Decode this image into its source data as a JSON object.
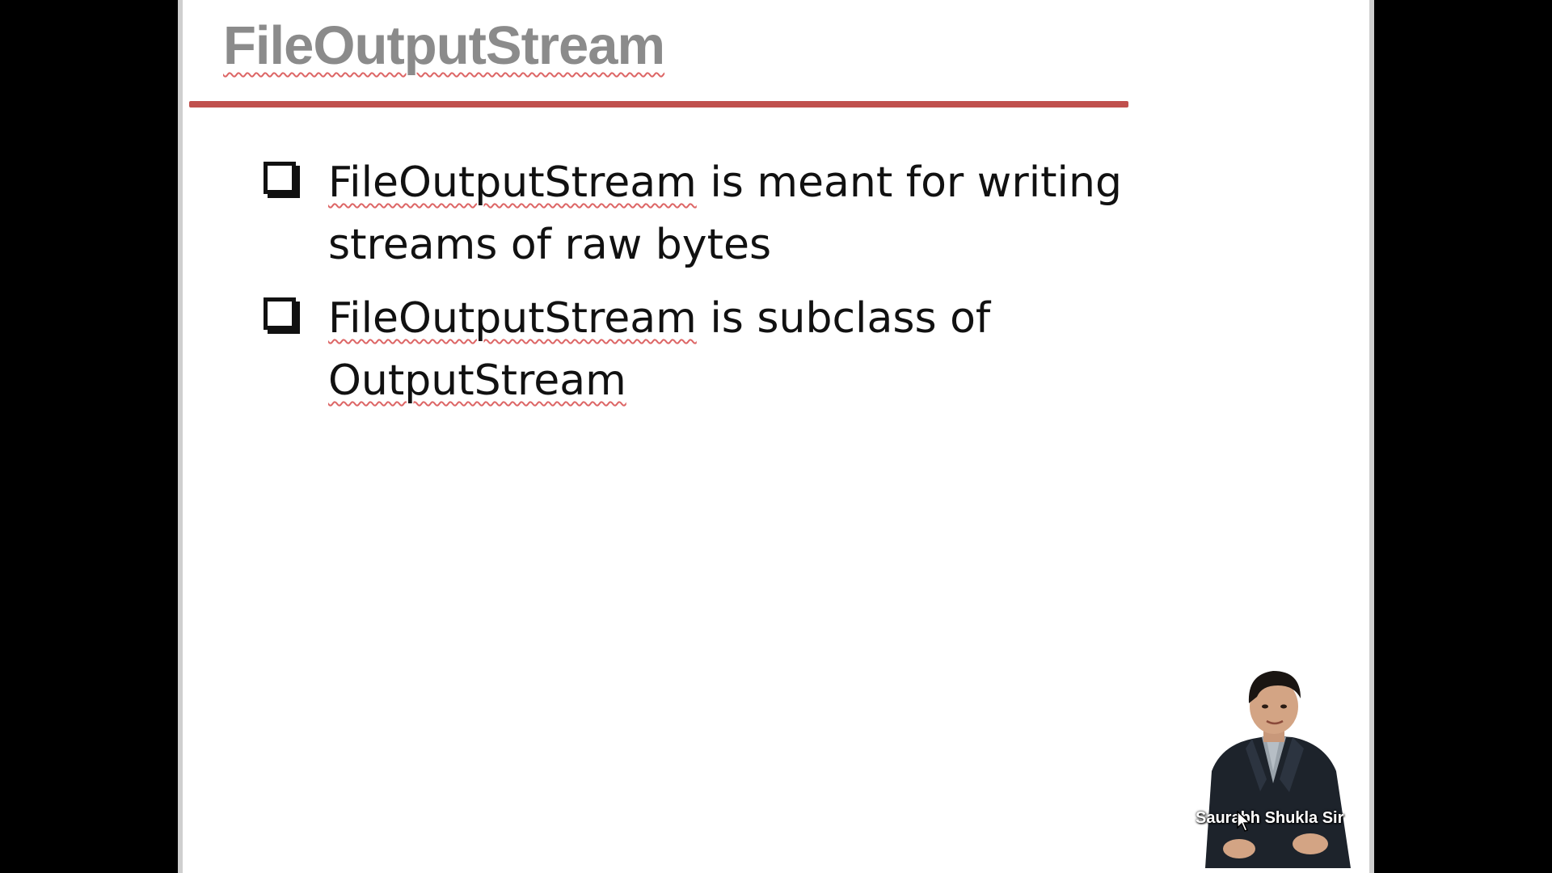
{
  "slide": {
    "title": "FileOutputStream",
    "accent_color": "#c0504d",
    "bullets": [
      {
        "term": "FileOutputStream",
        "rest": " is meant for writing streams of raw bytes"
      },
      {
        "term": "FileOutputStream",
        "rest": " is subclass of ",
        "term2": "OutputStream"
      }
    ]
  },
  "presenter": {
    "name": "Saurabh Shukla Sir"
  },
  "icons": {
    "bullet": "checkbox-bullet-icon",
    "cursor": "mouse-cursor-icon"
  }
}
